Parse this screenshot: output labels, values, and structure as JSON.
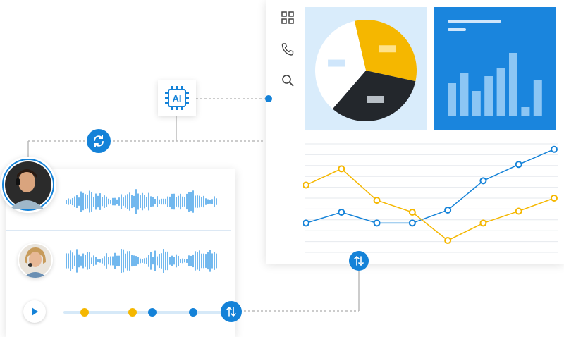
{
  "nav": {
    "items": [
      {
        "icon": "grid-icon"
      },
      {
        "icon": "phone-icon"
      },
      {
        "icon": "search-icon"
      }
    ]
  },
  "ai_chip": {
    "label": "AI"
  },
  "colors": {
    "primary": "#1482d8",
    "accent": "#f5b700",
    "dark": "#23272c",
    "light_blue": "#d9ecfb",
    "bar_blue": "#1a85dd"
  },
  "chart_data": [
    {
      "type": "pie",
      "values": [
        32,
        33,
        35
      ],
      "colors": [
        "#f5b700",
        "#23272c",
        "#ffffff"
      ]
    },
    {
      "type": "bar",
      "values": [
        47,
        62,
        36,
        57,
        68,
        90,
        13,
        52
      ],
      "ylim": [
        0,
        100
      ]
    },
    {
      "type": "line",
      "x": [
        1,
        2,
        3,
        4,
        5,
        6,
        7,
        8
      ],
      "series": [
        {
          "color": "#1482d8",
          "values": [
            27,
            37,
            27,
            27,
            39,
            66,
            81,
            95
          ]
        },
        {
          "color": "#f5b700",
          "values": [
            62,
            77,
            48,
            37,
            11,
            27,
            38,
            50
          ]
        }
      ],
      "ylim": [
        0,
        100
      ],
      "grid": true
    }
  ],
  "audio": {
    "speakers": [
      {
        "name": "agent",
        "avatar": "headset-agent-avatar"
      },
      {
        "name": "customer",
        "avatar": "customer-avatar"
      }
    ],
    "timeline_markers": [
      "yellow",
      "yellow",
      "blue",
      "blue"
    ]
  }
}
